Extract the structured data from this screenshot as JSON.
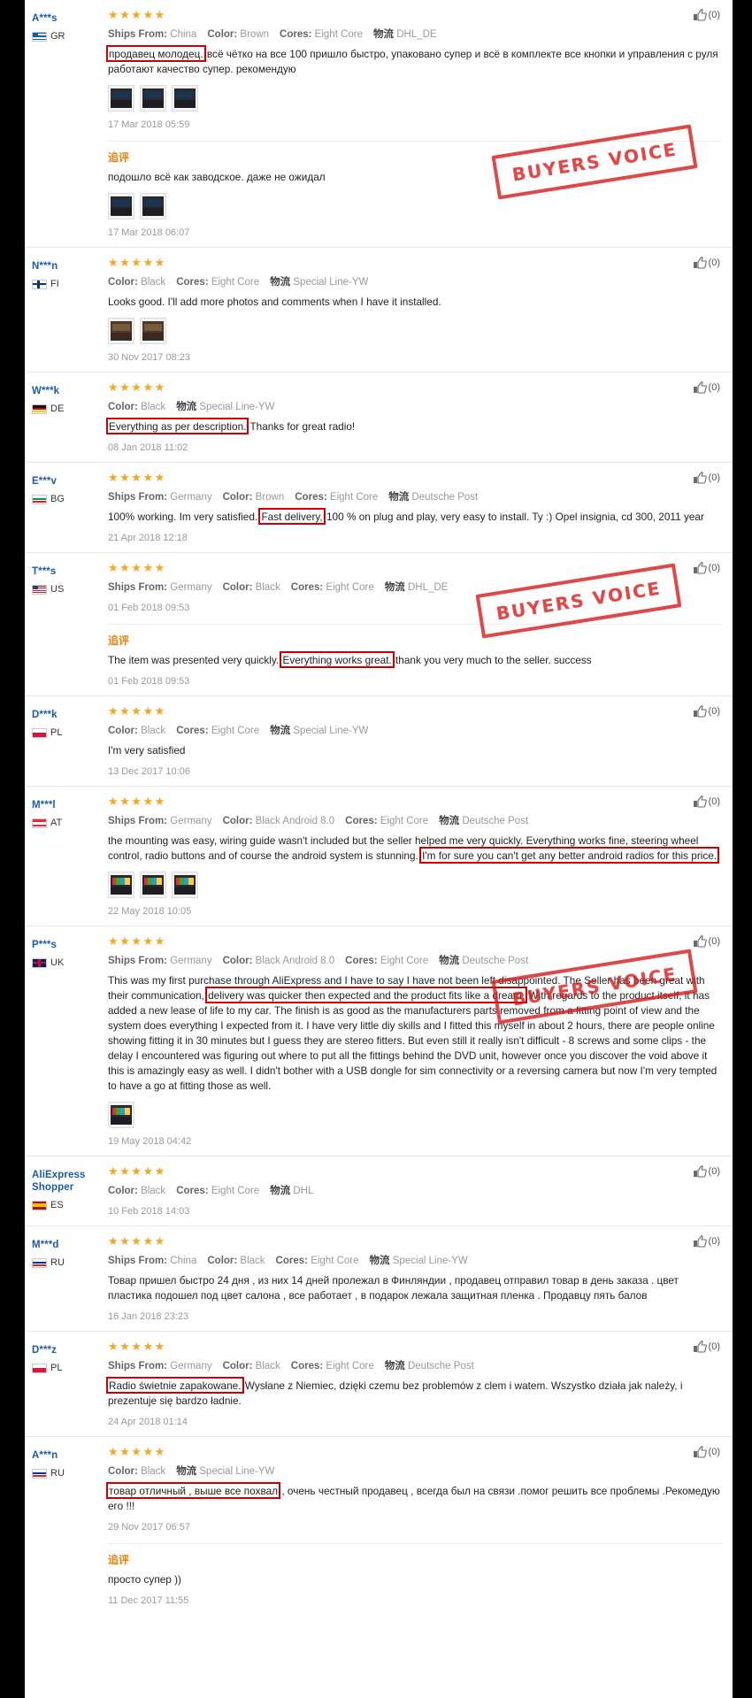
{
  "labels": {
    "ships_from": "Ships From:",
    "color": "Color:",
    "cores": "Cores:",
    "logistics_cjk": "物流",
    "append_label": "追评",
    "stamp_text": "BUYERS VOICE",
    "helpful_count": "(0)"
  },
  "reviews": [
    {
      "buyer": "A***s",
      "country": "GR",
      "flag": "gr",
      "stars": "★★★★★",
      "helpful": "(0)",
      "attrs": {
        "ships_from": "China",
        "color": "Brown",
        "cores": "Eight Core",
        "logistics": "DHL_DE"
      },
      "highlight": "продавец молодец.",
      "text": " всё чётко на все 100 пришло быстро, упаковано супер и всё в комплекте все кнопки и управления с руля работают качество супер. рекомендую",
      "photos": 3,
      "photo_style": "dash",
      "date": "17 Mar 2018 05:59",
      "append": {
        "text": "подошло всё как заводское. даже не ожидал",
        "photos": 2,
        "photo_style": "dash",
        "date": "17 Mar 2018 06:07"
      }
    },
    {
      "buyer": "N***n",
      "country": "FI",
      "flag": "fi",
      "stars": "★★★★★",
      "helpful": "(0)",
      "attrs": {
        "color": "Black",
        "cores": "Eight Core",
        "logistics": "Special Line-YW"
      },
      "text": "Looks good. I'll add more photos and comments when I have it installed.",
      "photos": 2,
      "photo_style": "brown",
      "date": "30 Nov 2017 08:23"
    },
    {
      "buyer": "W***k",
      "country": "DE",
      "flag": "de",
      "stars": "★★★★★",
      "helpful": "(0)",
      "attrs": {
        "color": "Black",
        "logistics": "Special Line-YW"
      },
      "highlight": "Everything as per description.",
      "text": " Thanks for great radio!",
      "photos": 0,
      "date": "08 Jan 2018 11:02"
    },
    {
      "buyer": "E***v",
      "country": "BG",
      "flag": "bg",
      "stars": "★★★★★",
      "helpful": "(0)",
      "attrs": {
        "ships_from": "Germany",
        "color": "Brown",
        "cores": "Eight Core",
        "logistics": "Deutsche Post"
      },
      "pre_text": "100% working. Im very satisfied. ",
      "highlight": "Fast delivery,",
      "text": " 100 % on plug and play, very easy to install. Ty :) Opel insignia, cd 300, 2011 year",
      "photos": 0,
      "date": "21 Apr 2018 12:18"
    },
    {
      "buyer": "T***s",
      "country": "US",
      "flag": "us",
      "stars": "★★★★★",
      "helpful": "(0)",
      "attrs": {
        "ships_from": "Germany",
        "color": "Black",
        "cores": "Eight Core",
        "logistics": "DHL_DE"
      },
      "text": "",
      "photos": 0,
      "date": "01 Feb 2018 09:53",
      "append": {
        "pre_text": "The item was presented very quickly. ",
        "highlight": "Everything works great.",
        "text": " thank you very much to the seller. success",
        "photos": 0,
        "date": "01 Feb 2018 09:53"
      }
    },
    {
      "buyer": "D***k",
      "country": "PL",
      "flag": "pl",
      "stars": "★★★★★",
      "helpful": "(0)",
      "attrs": {
        "color": "Black",
        "cores": "Eight Core",
        "logistics": "Special Line-YW"
      },
      "text": "I'm very satisfied",
      "photos": 0,
      "date": "13 Dec 2017 10:06"
    },
    {
      "buyer": "M***l",
      "country": "AT",
      "flag": "at",
      "stars": "★★★★★",
      "helpful": "(0)",
      "attrs": {
        "ships_from": "Germany",
        "color": "Black Android 8.0",
        "cores": "Eight Core",
        "logistics": "Deutsche Post"
      },
      "pre_text": "the mounting was easy, wiring guide wasn't included but the seller helped me very quickly. Everything works fine, steering wheel control, radio buttons and of course the android system is stunning. ",
      "highlight": "I'm for sure you can't get any better android radios for this price.",
      "text": "",
      "photos": 3,
      "photo_style": "color",
      "date": "22 May 2018 10:05"
    },
    {
      "buyer": "P***s",
      "country": "UK",
      "flag": "uk",
      "stars": "★★★★★",
      "helpful": "(0)",
      "attrs": {
        "ships_from": "Germany",
        "color": "Black Android 8.0",
        "cores": "Eight Core",
        "logistics": "Deutsche Post"
      },
      "pre_text": "This was my first purchase through AliExpress and I have to say I have not been left disappointed. The Seller has been great with their communication, ",
      "highlight": "delivery was quicker then expected and the product fits like a dream.",
      "text": " With regards to the product itself, it has added a new lease of life to my car. The finish is as good as the manufacturers parts removed from a fitting point of view and the system does everything I expected from it. I have very little diy skills and I fitted this myself in about 2 hours, there are people online showing fitting it in 30 minutes but I guess they are stereo fitters. But even still it really isn't difficult - 8 screws and some clips - the delay I encountered was figuring out where to put all the fittings behind the DVD unit, however once you discover the void above it this is amazingly easy as well. I didn't bother with a USB dongle for sim connectivity or a reversing camera but now I'm very tempted to have a go at fitting those as well.",
      "photos": 1,
      "photo_style": "color",
      "date": "19 May 2018 04:42"
    },
    {
      "buyer": "AliExpress Shopper",
      "country": "ES",
      "flag": "es",
      "stars": "★★★★★",
      "helpful": "(0)",
      "attrs": {
        "color": "Black",
        "cores": "Eight Core",
        "logistics": "DHL"
      },
      "text": "",
      "photos": 0,
      "date": "10 Feb 2018 14:03"
    },
    {
      "buyer": "M***d",
      "country": "RU",
      "flag": "ru",
      "stars": "★★★★★",
      "helpful": "(0)",
      "attrs": {
        "ships_from": "China",
        "color": "Black",
        "cores": "Eight Core",
        "logistics": "Special Line-YW"
      },
      "text": "Товар пришел быстро 24 дня , из них 14 дней пролежал в Финляндии , продавец отправил товар в день заказа . цвет пластика подошел под цвет салона , все работает , в подарок лежала защитная пленка . Продавцу пять балов",
      "photos": 0,
      "date": "16 Jan 2018 23:23"
    },
    {
      "buyer": "D***z",
      "country": "PL",
      "flag": "pl",
      "stars": "★★★★★",
      "helpful": "(0)",
      "attrs": {
        "ships_from": "Germany",
        "color": "Black",
        "cores": "Eight Core",
        "logistics": "Deutsche Post"
      },
      "highlight": "Radio świetnie zapakowane.",
      "text": " Wysłane z Niemiec, dzięki czemu bez problemów z clem i watem. Wszystko działa jak należy, i prezentuje się bardzo ładnie.",
      "photos": 0,
      "date": "24 Apr 2018 01:14"
    },
    {
      "buyer": "A***n",
      "country": "RU",
      "flag": "ru",
      "stars": "★★★★★",
      "helpful": "(0)",
      "attrs": {
        "color": "Black",
        "logistics": "Special Line-YW"
      },
      "highlight": "товар отличный , выше все похвал",
      "text": " , очень честный продавец , всегда был на связи .помог решить все проблемы .Рекомедую его !!!",
      "photos": 0,
      "date": "29 Nov 2017 06:57",
      "append": {
        "text": "просто супер ))",
        "photos": 0,
        "date": "11 Dec 2017 11:55"
      }
    }
  ],
  "stamps": [
    {
      "text": "BUYERS VOICE"
    },
    {
      "text": "BUYERS VOICE"
    },
    {
      "text": "BUYERS VOICE"
    }
  ]
}
